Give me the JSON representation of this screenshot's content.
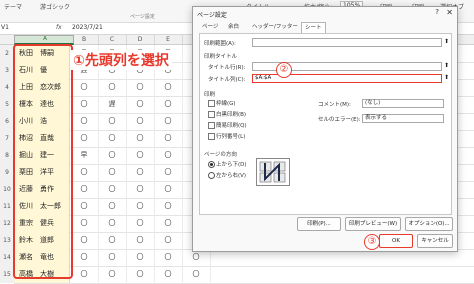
{
  "ribbon": {
    "font_label": "游ゴシック",
    "page_label": "ページ設定",
    "theme_label": "テーマ",
    "title_label": "タイトル",
    "zoom_label": "拡大/縮小:",
    "zoom_value": "105%",
    "print_label": "印刷",
    "print2_label": "印刷",
    "select_label": "選択オブ"
  },
  "formula_bar": {
    "name_box": "V1",
    "fx": "fx",
    "value": "2023/7/21"
  },
  "columns": [
    "A",
    "B",
    "C",
    "D",
    "E",
    "F"
  ],
  "rows": [
    {
      "num": "2",
      "name": "秋田　博嗣",
      "cells": [
        "〇",
        "〇",
        "〇",
        "〇",
        "〇"
      ]
    },
    {
      "num": "3",
      "name": "石川　優",
      "cells": [
        "遅",
        "〇",
        "〇",
        "〇",
        "〇"
      ]
    },
    {
      "num": "4",
      "name": "上田　恋次郎",
      "cells": [
        "〇",
        "〇",
        "〇",
        "〇",
        "〇"
      ]
    },
    {
      "num": "5",
      "name": "榎本　達也",
      "cells": [
        "〇",
        "遅",
        "〇",
        "〇",
        "〇"
      ]
    },
    {
      "num": "6",
      "name": "小川　浩",
      "cells": [
        "〇",
        "〇",
        "〇",
        "〇",
        "〇"
      ]
    },
    {
      "num": "7",
      "name": "柿沼　直哉",
      "cells": [
        "〇",
        "〇",
        "〇",
        "〇",
        "〇"
      ]
    },
    {
      "num": "8",
      "name": "掘山　建一",
      "cells": [
        "早",
        "〇",
        "〇",
        "〇",
        "〇"
      ]
    },
    {
      "num": "9",
      "name": "栗田　洋平",
      "cells": [
        "〇",
        "〇",
        "〇",
        "〇",
        "〇"
      ]
    },
    {
      "num": "10",
      "name": "近藤　勇作",
      "cells": [
        "〇",
        "〇",
        "〇",
        "〇",
        "〇"
      ]
    },
    {
      "num": "11",
      "name": "佐川　太一郎",
      "cells": [
        "〇",
        "〇",
        "〇",
        "〇",
        "〇"
      ]
    },
    {
      "num": "12",
      "name": "重宗　健兵",
      "cells": [
        "〇",
        "〇",
        "〇",
        "〇",
        "〇"
      ]
    },
    {
      "num": "13",
      "name": "鈴木　道郎",
      "cells": [
        "〇",
        "〇",
        "〇",
        "〇",
        "〇"
      ]
    },
    {
      "num": "14",
      "name": "瀬名　竜也",
      "cells": [
        "〇",
        "〇",
        "〇",
        "〇",
        "〇"
      ]
    },
    {
      "num": "15",
      "name": "高橋　大樹",
      "cells": [
        "〇",
        "〇",
        "〇",
        "〇",
        "〇"
      ]
    }
  ],
  "annotations": {
    "a1": "①先頭列を選択",
    "a2": "②",
    "a3": "③"
  },
  "dialog": {
    "title": "ページ設定",
    "help": "?",
    "close": "✕",
    "tabs": [
      "ページ",
      "余白",
      "ヘッダー/フッター",
      "シート"
    ],
    "print_area_label": "印刷範囲(A):",
    "print_titles_label": "印刷タイトル",
    "title_rows_label": "タイトル行(R):",
    "title_cols_label": "タイトル列(C):",
    "title_cols_value": "$A:$A",
    "print_section_label": "印刷",
    "checks": [
      "枠線(G)",
      "白黒印刷(B)",
      "簡易印刷(Q)",
      "行列番号(L)"
    ],
    "comments_label": "コメント(M):",
    "comments_value": "(なし)",
    "errors_label": "セルのエラー(E):",
    "errors_value": "表示する",
    "order_label": "ページの方向",
    "order_down": "上から下(D)",
    "order_over": "左から右(V)",
    "print_btn": "印刷(P)...",
    "preview_btn": "印刷プレビュー(W)",
    "options_btn": "オプション(O)...",
    "ok_btn": "OK",
    "cancel_btn": "キャンセル"
  },
  "colors": {
    "accent_red": "#e8392d",
    "cell_highlight": "#fff7d6",
    "excel_green": "#217346"
  }
}
